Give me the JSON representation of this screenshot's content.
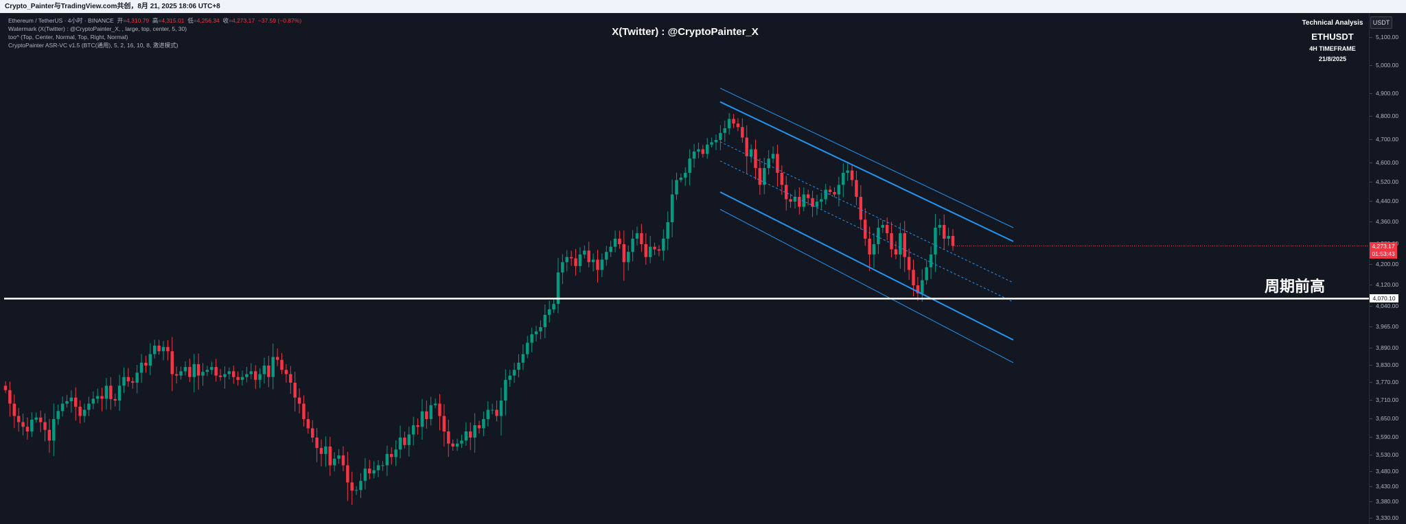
{
  "header": {
    "text": "Crypto_Painter与TradingView.com共创，8月 21, 2025 18:06 UTC+8"
  },
  "legend": {
    "line1_prefix": "Ethereum / TetherUS · 4小时 · BINANCE",
    "open_label": "开",
    "open": "=4,310.79",
    "high_label": "高",
    "high": "=4,315.01",
    "low_label": "低",
    "low": "=4,256.34",
    "close_label": "收",
    "close": "=4,273.17",
    "change": "−37.59 (−0.87%)",
    "line2": "Watermark (X(Twitter) : @CryptoPainter_X, , large, top, center, 5, 30)",
    "line3": "too^ (Top, Center, Normal, Top, Right, Normal)",
    "line4": "CryptoPainter ASR-VC v1.5 (BTC(通用), 5, 2, 16, 10, 8, 激进模式)"
  },
  "watermark": "X(Twitter) : @CryptoPainter_X",
  "ta_panel": {
    "title": "Technical Analysis",
    "symbol": "ETHUSDT",
    "timeframe": "4H TIMEFRAME",
    "date": "21/8/2025"
  },
  "currency_badge": "USDT",
  "level_label": "周期前高",
  "colors": {
    "up": "#089981",
    "down": "#f23645",
    "channel": "#2196f3",
    "level": "#ffffff"
  },
  "chart_data": {
    "type": "candlestick",
    "symbol": "ETHUSDT",
    "timeframe": "4H",
    "y_ticks": [
      5100,
      5000,
      4900,
      4800,
      4700,
      4600,
      4520,
      4440,
      4360,
      4280,
      4200,
      4120,
      4040,
      3965,
      3890,
      3830,
      3770,
      3710,
      3650,
      3590,
      3530,
      3480,
      3430,
      3380,
      3330
    ],
    "y_tick_labels": [
      "5,100.00",
      "5,000.00",
      "4,900.00",
      "4,800.00",
      "4,700.00",
      "4,600.00",
      "4,520.00",
      "4,440.00",
      "4,360.00",
      "4,280.00",
      "4,200.00",
      "4,120.00",
      "4,040.00",
      "3,965.00",
      "3,890.00",
      "3,830.00",
      "3,770.00",
      "3,710.00",
      "3,650.00",
      "3,590.00",
      "3,530.00",
      "3,480.00",
      "3,430.00",
      "3,380.00",
      "3,330.00"
    ],
    "last_price": {
      "value": 4273.17,
      "label": "4,273.17",
      "countdown": "01:53:43"
    },
    "horizontal_level": {
      "value": 4070.1,
      "label": "4,070.10"
    },
    "closes": [
      3745,
      3700,
      3660,
      3640,
      3625,
      3610,
      3648,
      3655,
      3640,
      3615,
      3580,
      3650,
      3676,
      3700,
      3708,
      3720,
      3690,
      3660,
      3680,
      3700,
      3716,
      3725,
      3716,
      3760,
      3715,
      3710,
      3760,
      3790,
      3775,
      3770,
      3805,
      3840,
      3830,
      3870,
      3900,
      3880,
      3895,
      3880,
      3800,
      3795,
      3810,
      3825,
      3790,
      3835,
      3795,
      3808,
      3815,
      3825,
      3795,
      3790,
      3800,
      3810,
      3790,
      3780,
      3790,
      3800,
      3810,
      3780,
      3800,
      3830,
      3790,
      3860,
      3850,
      3815,
      3800,
      3770,
      3720,
      3700,
      3650,
      3620,
      3590,
      3555,
      3535,
      3560,
      3500,
      3520,
      3530,
      3500,
      3445,
      3418,
      3420,
      3450,
      3490,
      3475,
      3485,
      3500,
      3500,
      3535,
      3525,
      3550,
      3590,
      3565,
      3600,
      3630,
      3625,
      3675,
      3650,
      3695,
      3700,
      3660,
      3610,
      3570,
      3560,
      3570,
      3580,
      3610,
      3590,
      3630,
      3620,
      3650,
      3680,
      3680,
      3660,
      3710,
      3780,
      3795,
      3815,
      3840,
      3870,
      3910,
      3940,
      3950,
      3965,
      4010,
      4030,
      4050,
      4170,
      4210,
      4230,
      4225,
      4195,
      4240,
      4255,
      4210,
      4220,
      4180,
      4220,
      4250,
      4270,
      4300,
      4280,
      4210,
      4250,
      4300,
      4320,
      4280,
      4230,
      4270,
      4260,
      4255,
      4300,
      4360,
      4470,
      4530,
      4540,
      4560,
      4620,
      4650,
      4660,
      4640,
      4680,
      4690,
      4700,
      4730,
      4750,
      4790,
      4770,
      4755,
      4710,
      4630,
      4660,
      4580,
      4510,
      4580,
      4620,
      4640,
      4560,
      4510,
      4450,
      4440,
      4460,
      4420,
      4470,
      4455,
      4420,
      4440,
      4450,
      4490,
      4480,
      4470,
      4510,
      4560,
      4570,
      4530,
      4460,
      4370,
      4300,
      4240,
      4280,
      4340,
      4350,
      4320,
      4260,
      4240,
      4320,
      4230,
      4180,
      4120,
      4090,
      4140,
      4190,
      4240,
      4340,
      4350,
      4300,
      4310,
      4273.17
    ],
    "channel": {
      "upper_start": 4865,
      "upper_end": 4290,
      "mid_start": 4780,
      "mid_end": 4210,
      "lower_start": 4480,
      "lower_end": 3920,
      "bottom_start": 4410,
      "bottom_end": 3840
    }
  }
}
